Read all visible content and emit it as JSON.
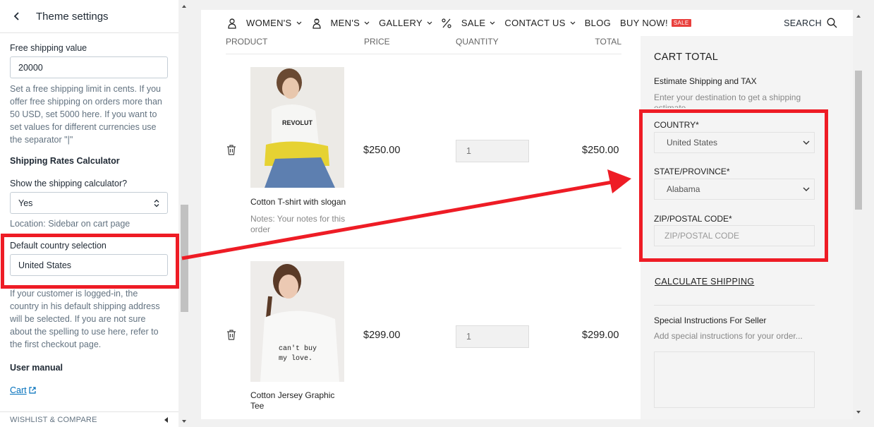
{
  "panel": {
    "title": "Theme settings",
    "free_shipping_label": "Free shipping value",
    "free_shipping_value": "20000",
    "free_shipping_help": "Set a free shipping limit in cents. If you offer free shipping on orders more than 50 USD, set 5000 here. If you want to set values for different currencies use the separator \"|\"",
    "calculator_section": "Shipping Rates Calculator",
    "show_calculator_label": "Show the shipping calculator?",
    "show_calculator_value": "Yes",
    "location_text": "Location: Sidebar on cart page",
    "default_country_label": "Default country selection",
    "default_country_value": "United States",
    "default_country_help": "If your customer is logged-in, the country in his default shipping address will be selected. If you are not sure about the spelling to use here, refer to the first checkout page.",
    "manual_section": "User manual",
    "manual_link": "Cart",
    "footer_label": "WISHLIST & COMPARE"
  },
  "nav": {
    "items": [
      {
        "label": "WOMEN'S",
        "icon": "woman-icon",
        "dropdown": true
      },
      {
        "label": "MEN'S",
        "icon": "man-icon",
        "dropdown": true
      },
      {
        "label": "GALLERY",
        "icon": "",
        "dropdown": true
      },
      {
        "label": "SALE",
        "icon": "percent-icon",
        "dropdown": true
      },
      {
        "label": "CONTACT US",
        "icon": "",
        "dropdown": true
      },
      {
        "label": "BLOG",
        "icon": "",
        "dropdown": false
      },
      {
        "label": "BUY NOW!",
        "icon": "",
        "dropdown": false,
        "badge": "SALE"
      }
    ],
    "search_label": "SEARCH"
  },
  "cart": {
    "headers": {
      "product": "PRODUCT",
      "price": "PRICE",
      "quantity": "QUANTITY",
      "total": "TOTAL"
    },
    "items": [
      {
        "name": "Cotton T-shirt with slogan",
        "notes": "Notes: Your notes for this order",
        "price": "$250.00",
        "qty": "1",
        "total": "$250.00",
        "image": "woman in white t-shirt with yellow jacket"
      },
      {
        "name": "Cotton Jersey Graphic Tee",
        "notes": "",
        "price": "$299.00",
        "qty": "1",
        "total": "$299.00",
        "image": "woman in white graphic tee"
      }
    ]
  },
  "cart_total": {
    "title": "CART TOTAL",
    "estimate_title": "Estimate Shipping and TAX",
    "estimate_help": "Enter your destination to get a shipping estimate.",
    "country_label": "COUNTRY*",
    "country_value": "United States",
    "state_label": "STATE/PROVINCE*",
    "state_value": "Alabama",
    "zip_label": "ZIP/POSTAL CODE*",
    "zip_placeholder": "ZIP/POSTAL CODE",
    "calculate_label": "CALCULATE SHIPPING",
    "instructions_title": "Special Instructions For Seller",
    "instructions_placeholder": "Add special instructions for your order..."
  },
  "colors": {
    "annotation": "#ee1c25",
    "sale_badge": "#e9403d",
    "link": "#006fbb"
  }
}
